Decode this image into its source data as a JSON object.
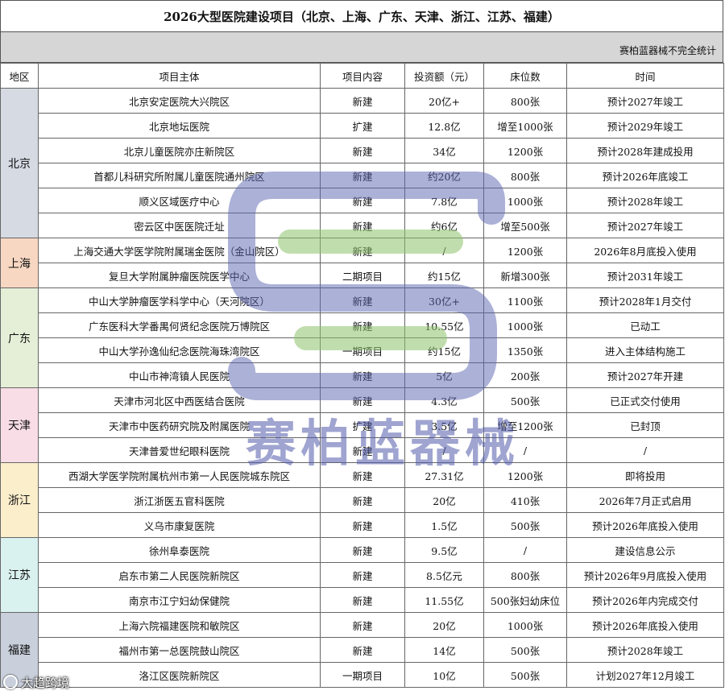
{
  "title": "2026大型医院建设项目（北京、上海、广东、天津、浙江、江苏、福建）",
  "note": "赛柏蓝器械不完全统计",
  "headers": [
    "地区",
    "项目主体",
    "项目内容",
    "投资额（元）",
    "床位数",
    "时间"
  ],
  "regions": [
    {
      "name": "北京",
      "rows": [
        [
          "北京安定医院大兴院区",
          "新建",
          "20亿+",
          "800张",
          "预计2027年竣工"
        ],
        [
          "北京地坛医院",
          "扩建",
          "12.8亿",
          "增至1000张",
          "预计2029年竣工"
        ],
        [
          "北京儿童医院亦庄新院区",
          "新建",
          "34亿",
          "1200张",
          "预计2028年建成投用"
        ],
        [
          "首都儿科研究所附属儿童医院通州院区",
          "新建",
          "约20亿",
          "800张",
          "预计2026年底竣工"
        ],
        [
          "顺义区域医疗中心",
          "新建",
          "7.8亿",
          "1000张",
          "预计2028年竣工"
        ],
        [
          "密云区中医医院迁址",
          "新建",
          "约6亿",
          "增至500张",
          "预计2027年竣工"
        ]
      ]
    },
    {
      "name": "上海",
      "rows": [
        [
          "上海交通大学医学院附属瑞金医院（金山院区）",
          "新建",
          "/",
          "1200张",
          "2026年8月底投入使用"
        ],
        [
          "复旦大学附属肿瘤医院医学中心",
          "二期项目",
          "约15亿",
          "新增300张",
          "预计2031年竣工"
        ]
      ]
    },
    {
      "name": "广东",
      "rows": [
        [
          "中山大学肿瘤医学科学中心（天河院区）",
          "新建",
          "30亿+",
          "1100张",
          "预计2028年1月交付"
        ],
        [
          "广东医科大学番禺何贤纪念医院万博院区",
          "新建",
          "10.55亿",
          "1000张",
          "已动工"
        ],
        [
          "中山大学孙逸仙纪念医院海珠湾院区",
          "一期项目",
          "约15亿",
          "1350张",
          "进入主体结构施工"
        ],
        [
          "中山市神湾镇人民医院",
          "新建",
          "5亿",
          "200张",
          "预计2027年开建"
        ]
      ]
    },
    {
      "name": "天津",
      "rows": [
        [
          "天津市河北区中西医结合医院",
          "新建",
          "4.3亿",
          "500张",
          "已正式交付使用"
        ],
        [
          "天津市中医药研究院及附属医院",
          "扩建",
          "3.5亿",
          "增至1200张",
          "已封顶"
        ],
        [
          "天津普爱世纪眼科医院",
          "新建",
          "/",
          "/",
          "/"
        ]
      ]
    },
    {
      "name": "浙江",
      "rows": [
        [
          "西湖大学医学院附属杭州市第一人民医院城东院区",
          "新建",
          "27.31亿",
          "1200张",
          "即将投用"
        ],
        [
          "浙江浙医五官科医院",
          "新建",
          "20亿",
          "410张",
          "2026年7月正式启用"
        ],
        [
          "义乌市康复医院",
          "新建",
          "1.5亿",
          "500张",
          "预计2026年底投入使用"
        ]
      ]
    },
    {
      "name": "江苏",
      "rows": [
        [
          "徐州阜泰医院",
          "新建",
          "9.5亿",
          "/",
          "建设信息公示"
        ],
        [
          "启东市第二人民医院新院区",
          "新建",
          "8.5亿元",
          "800张",
          "预计2026年9月底投入使用"
        ],
        [
          "南京市江宁妇幼保健院",
          "新建",
          "11.55亿",
          "500张妇幼床位",
          "预计2026年内完成交付"
        ]
      ]
    },
    {
      "name": "福建",
      "rows": [
        [
          "上海六院福建医院和敏院区",
          "新建",
          "20亿",
          "1000张",
          "预计2026年底投入使用"
        ],
        [
          "福州市第一总医院鼓山院区",
          "新建",
          "14亿",
          "500张",
          "预计2028年竣工"
        ],
        [
          "洛江区医院新院区",
          "一期项目",
          "10亿",
          "500张",
          "计划2027年12月竣工"
        ]
      ]
    }
  ],
  "watermark": "赛柏蓝器械",
  "corner_label": "大趋跨境",
  "colors": {
    "beijing": "#d5dae3",
    "shanghai": "#f8d7c2",
    "guangdong": "#e5efd7",
    "tianjin": "#f8dde6",
    "zhejiang": "#fbeecb",
    "jiangsu": "#d9f1ef",
    "fujian": "#c9d0dc",
    "watermark_blue": "#5a64b0",
    "watermark_green": "#8cc36a"
  }
}
